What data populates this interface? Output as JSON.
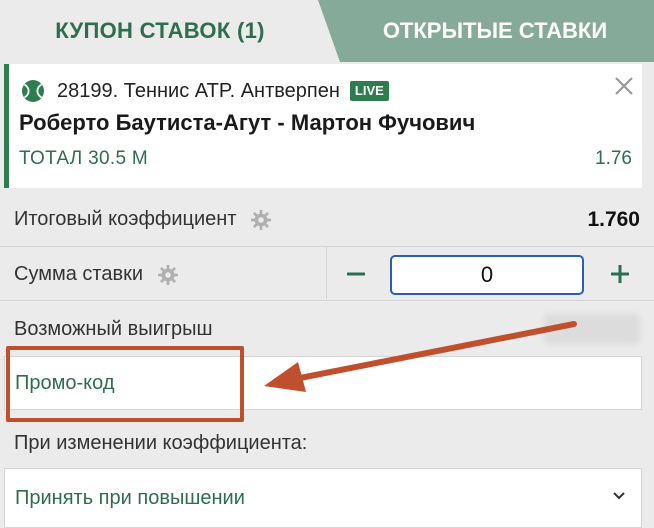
{
  "tabs": {
    "coupon": "КУПОН СТАВОК (1)",
    "open_bets": "ОТКРЫТЫЕ СТАВКИ"
  },
  "bet": {
    "event": "28199. Теннис ATP. Антверпен",
    "live_badge": "LIVE",
    "match": "Роберто Баутиста-Агут - Мартон Фучович",
    "market": "ТОТАЛ 30.5 М",
    "odds": "1.76"
  },
  "summary": {
    "total_odds_label": "Итоговый коэффициент",
    "total_odds_value": "1.760",
    "stake_label": "Сумма ставки",
    "stake_value": "0",
    "possible_win_label": "Возможный выигрыш",
    "promo_code": "Промо-код"
  },
  "odds_change": {
    "label": "При изменении коэффициента:",
    "selected": "Принять при повышении"
  },
  "colors": {
    "accent_green": "#2e7d4f",
    "inactive_tab": "#86aa99",
    "annotation": "#c0502d",
    "input_border": "#2b5db8"
  },
  "icons": [
    "tennis-ball-icon",
    "close-icon",
    "gear-icon",
    "minus-icon",
    "plus-icon",
    "chevron-down-icon"
  ]
}
